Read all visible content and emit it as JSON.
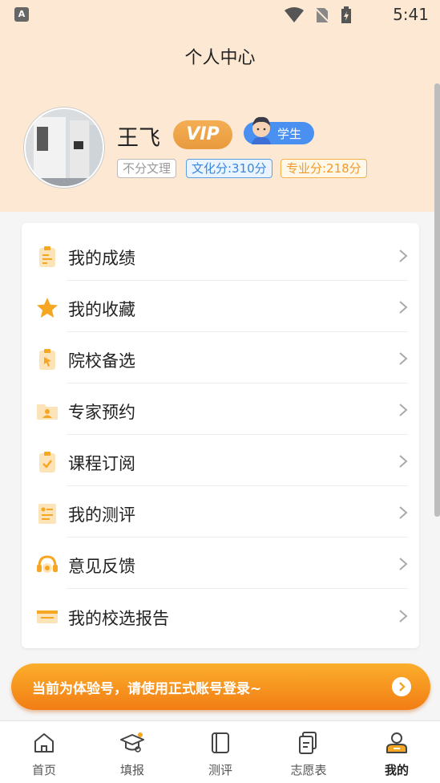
{
  "status_bar": {
    "app_indicator": "A",
    "time": "5:41"
  },
  "header": {
    "title": "个人中心"
  },
  "profile": {
    "name": "王飞",
    "vip_label": "VIP",
    "role_label": "学生",
    "tags": {
      "subject": "不分文理",
      "culture_score": "文化分:310分",
      "major_score": "专业分:218分"
    }
  },
  "menu": {
    "items": [
      {
        "label": "我的成绩",
        "icon": "clipboard-list-icon"
      },
      {
        "label": "我的收藏",
        "icon": "star-icon"
      },
      {
        "label": "院校备选",
        "icon": "clipboard-cursor-icon"
      },
      {
        "label": "专家预约",
        "icon": "folder-user-icon"
      },
      {
        "label": "课程订阅",
        "icon": "clipboard-check-icon"
      },
      {
        "label": "我的测评",
        "icon": "assessment-icon"
      },
      {
        "label": "意见反馈",
        "icon": "headset-icon"
      },
      {
        "label": "我的校选报告",
        "icon": "report-icon"
      }
    ]
  },
  "trial_banner": {
    "text": "当前为体验号，请使用正式账号登录~"
  },
  "tab_bar": {
    "tabs": [
      {
        "label": "首页",
        "icon": "home-icon"
      },
      {
        "label": "填报",
        "icon": "graduation-cap-icon"
      },
      {
        "label": "测评",
        "icon": "book-icon"
      },
      {
        "label": "志愿表",
        "icon": "document-icon"
      },
      {
        "label": "我的",
        "icon": "user-icon"
      }
    ],
    "active_index": 4
  },
  "colors": {
    "accent": "#f5a623",
    "header_bg": "#fde9d3",
    "blue": "#4a90f0"
  }
}
